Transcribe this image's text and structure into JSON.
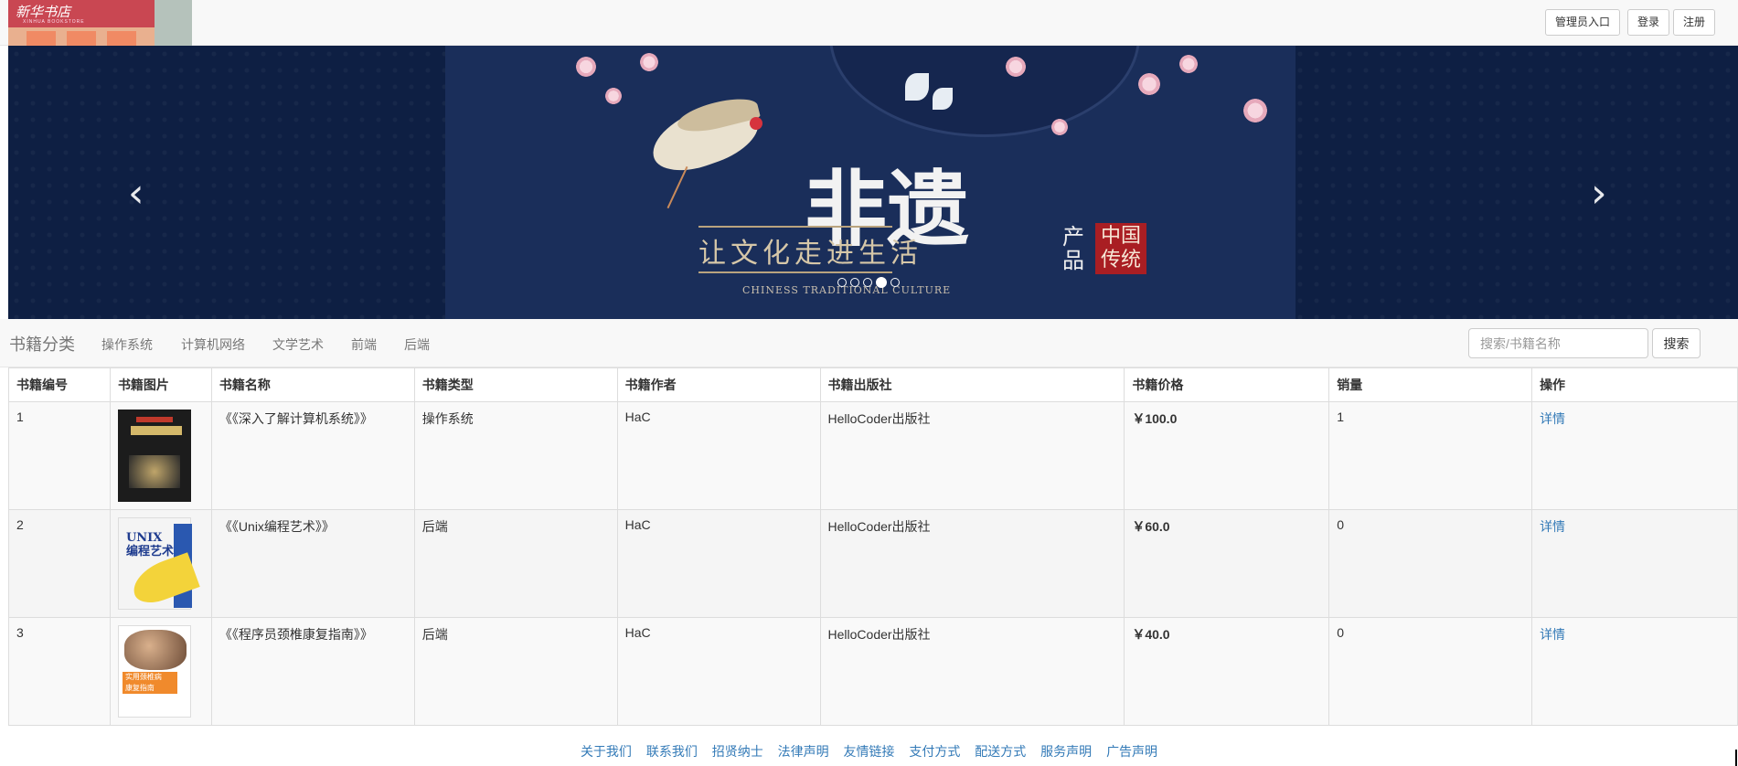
{
  "header": {
    "logo_text": "新华书店",
    "logo_sub": "XINHUA BOOKSTORE",
    "buttons": [
      {
        "label": "管理员入口"
      },
      {
        "label": "登录"
      },
      {
        "label": "注册"
      }
    ]
  },
  "carousel": {
    "big_text": "非遗",
    "slogan": "让文化走进生活",
    "subtitle": "CHINESS TRADITIONAL CULTURE",
    "stamp": "中国传统",
    "side_text": "产品",
    "slides_count": 5,
    "active_slide": 4,
    "prev_glyph": "‹",
    "next_glyph": "›"
  },
  "category": {
    "title": "书籍分类",
    "items": [
      "操作系统",
      "计算机网络",
      "文学艺术",
      "前端",
      "后端"
    ],
    "search_placeholder": "搜索/书籍名称",
    "search_button": "搜索"
  },
  "table": {
    "headers": [
      "书籍编号",
      "书籍图片",
      "书籍名称",
      "书籍类型",
      "书籍作者",
      "书籍出版社",
      "书籍价格",
      "销量",
      "操作"
    ],
    "rows": [
      {
        "id": "1",
        "name": "《《深入了解计算机系统》》",
        "type": "操作系统",
        "author": "HaC",
        "publisher": "HelloCoder出版社",
        "price": "￥100.0",
        "sales": "1",
        "action": "详情",
        "cover_title": "深入理解计算机系统"
      },
      {
        "id": "2",
        "name": "《《Unix编程艺术》》",
        "type": "后端",
        "author": "HaC",
        "publisher": "HelloCoder出版社",
        "price": "￥60.0",
        "sales": "0",
        "action": "详情",
        "cover_title": "UNIX 编程艺术"
      },
      {
        "id": "3",
        "name": "《《程序员颈椎康复指南》》",
        "type": "后端",
        "author": "HaC",
        "publisher": "HelloCoder出版社",
        "price": "￥40.0",
        "sales": "0",
        "action": "详情",
        "cover_title": "实用颈椎病康复指南"
      }
    ]
  },
  "footer": {
    "links": [
      "关于我们",
      "联系我们",
      "招贤纳士",
      "法律声明",
      "友情链接",
      "支付方式",
      "配送方式",
      "服务声明",
      "广告声明"
    ]
  },
  "colors": {
    "price": "#d9231d",
    "link": "#337ab7",
    "banner_bg": "#0e1f43"
  }
}
